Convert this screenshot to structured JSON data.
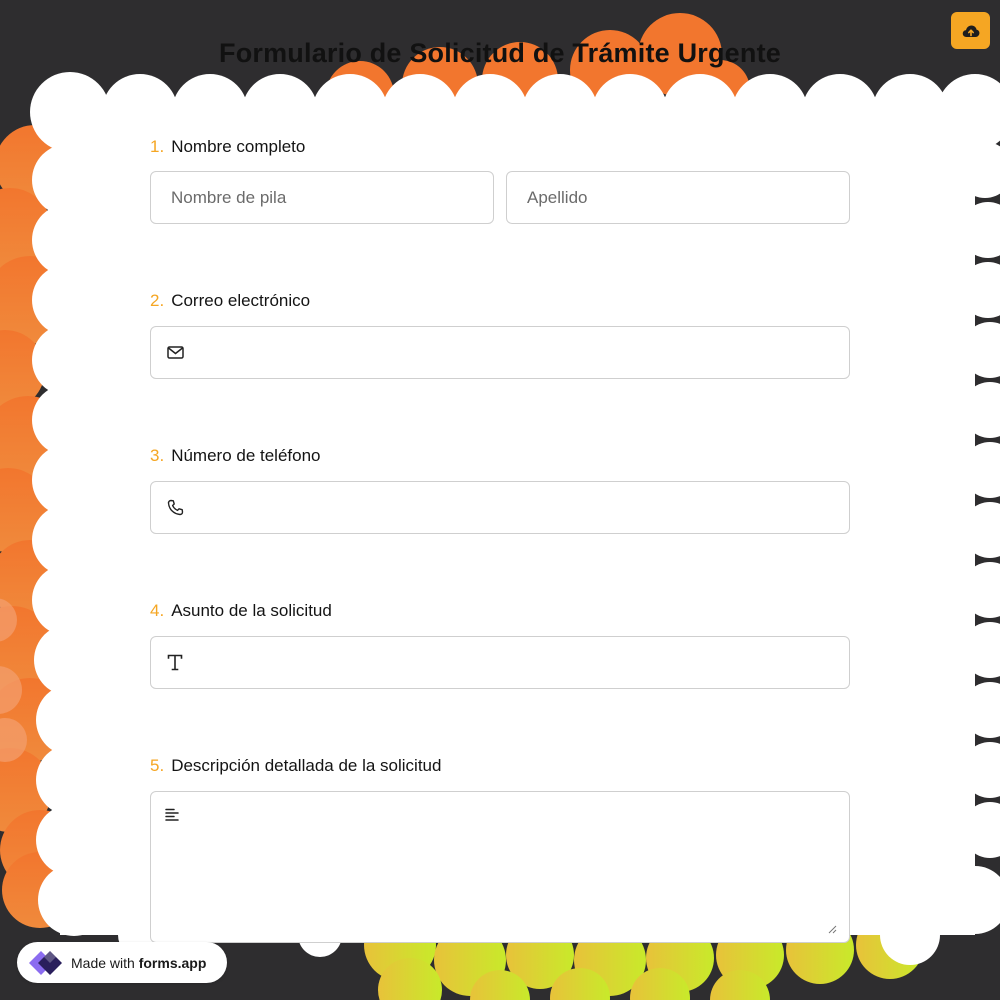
{
  "header": {
    "title": "Formulario de Solicitud de Trámite Urgente"
  },
  "toolbar": {
    "save_icon": "cloud-upload-icon",
    "accent_color": "#f5a623"
  },
  "questions": [
    {
      "number": "1.",
      "label": "Nombre completo",
      "fields": [
        {
          "placeholder": "Nombre de pila",
          "value": ""
        },
        {
          "placeholder": "Apellido",
          "value": ""
        }
      ]
    },
    {
      "number": "2.",
      "label": "Correo electrónico",
      "icon": "mail-icon",
      "value": ""
    },
    {
      "number": "3.",
      "label": "Número de teléfono",
      "icon": "phone-icon",
      "value": ""
    },
    {
      "number": "4.",
      "label": "Asunto de la solicitud",
      "icon": "text-type-icon",
      "value": ""
    },
    {
      "number": "5.",
      "label": "Descripción detallada de la solicitud",
      "icon": "align-left-icon",
      "value": ""
    }
  ],
  "branding": {
    "prefix": "Made with",
    "brand": "forms.app"
  }
}
